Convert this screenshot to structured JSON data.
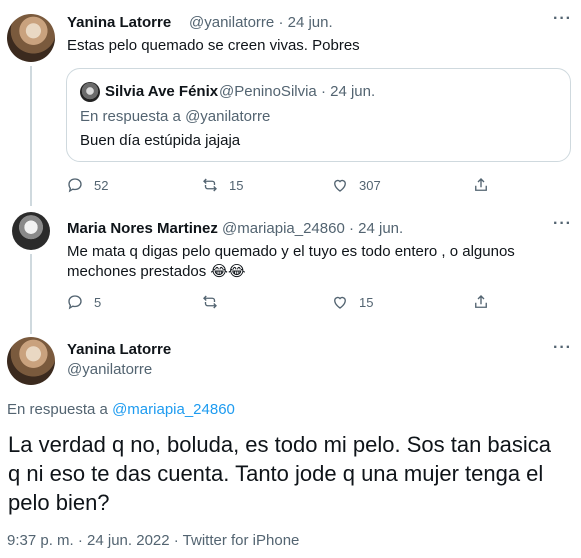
{
  "tweet1": {
    "name": "Yanina Latorre",
    "handle": "@yanilatorre",
    "dot": "·",
    "date": "24 jun.",
    "text": "Estas pelo quemado se creen vivas. Pobres",
    "quote": {
      "name": "Silvia Ave Fénix",
      "handle": "@PeninoSilvia",
      "dot": "·",
      "date": "24 jun.",
      "reply_prefix": "En respuesta a",
      "reply_handle": "@yanilatorre",
      "text": "Buen día estúpida jajaja"
    },
    "replies": "52",
    "retweets": "15",
    "likes": "307"
  },
  "tweet2": {
    "name": "Maria Nores Martinez",
    "handle": "@mariapia_24860",
    "dot": "·",
    "date": "24 jun.",
    "text_line1": "Me mata q digas pelo quemado y el tuyo es todo entero , o algunos",
    "text_line2": "mechones prestados 😂😂",
    "replies": "5",
    "retweets": "",
    "likes": "15"
  },
  "main_tweet": {
    "name": "Yanina Latorre",
    "handle": "@yanilatorre",
    "reply_prefix": "En respuesta a",
    "reply_handle": "@mariapia_24860",
    "text": "La verdad q no, boluda, es todo mi pelo. Sos tan basica q ni eso te das cuenta. Tanto jode q una mujer tenga el pelo bien?",
    "timestamp": "9:37 p. m. · 24 jun. 2022 · Twitter for iPhone"
  },
  "icons": {
    "more": "more-horizontal-icon",
    "reply": "reply-icon",
    "retweet": "retweet-icon",
    "like": "like-icon",
    "share": "share-icon"
  },
  "colors": {
    "text": "#0f1419",
    "secondary": "#536471",
    "link": "#1d9bf0",
    "border": "#cfd9de"
  }
}
